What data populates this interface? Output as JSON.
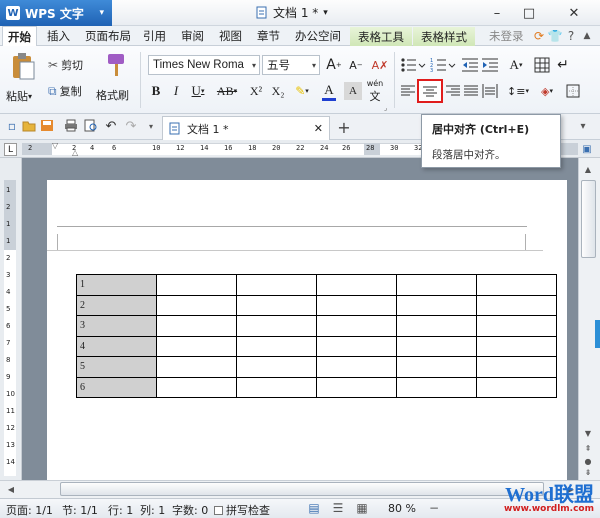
{
  "app": {
    "name": "WPS 文字",
    "dropdown": "▾"
  },
  "title": {
    "doc": "文档 1 *",
    "arrow": "▾"
  },
  "window": {
    "min": "–",
    "max": "□",
    "close": "✕"
  },
  "tabs": [
    {
      "label": "开始"
    },
    {
      "label": "插入"
    },
    {
      "label": "页面布局"
    },
    {
      "label": "引用"
    },
    {
      "label": "审阅"
    },
    {
      "label": "视图"
    },
    {
      "label": "章节"
    },
    {
      "label": "办公空间"
    },
    {
      "label": "表格工具"
    },
    {
      "label": "表格样式"
    }
  ],
  "account": {
    "login": "未登录",
    "help": "?"
  },
  "ribbon": {
    "paste": "粘贴",
    "cut": "剪切",
    "copy": "复制",
    "format_painter": "格式刷",
    "font_name": "Times New Roma",
    "font_size": "五号",
    "grow": "A",
    "shrink": "A",
    "bold": "B",
    "italic": "I",
    "underline": "U",
    "strike": "AB",
    "sup": "X²",
    "sub": "X₂",
    "font_color": "A",
    "char_shading": "A",
    "phonetic": "wén"
  },
  "tooltip": {
    "title": "居中对齐 (Ctrl+E)",
    "desc": "段落居中对齐。"
  },
  "doc_tab": {
    "label": "文档 1 *",
    "close": "✕",
    "add": "+"
  },
  "ruler": {
    "marks": [
      "2",
      "2",
      "4",
      "6",
      "10",
      "12",
      "14",
      "16",
      "18",
      "20",
      "22",
      "24",
      "26",
      "28",
      "30",
      "32",
      "34"
    ]
  },
  "vruler": {
    "marks": [
      "1",
      "2",
      "1",
      "1",
      "2",
      "3",
      "4",
      "5",
      "6",
      "7",
      "8",
      "9",
      "10",
      "11",
      "12",
      "13",
      "14"
    ]
  },
  "table": {
    "rows": [
      "1",
      "2",
      "3",
      "4",
      "5",
      "6"
    ],
    "cols": 6
  },
  "status": {
    "page": "页面: 1/1",
    "section": "节: 1/1",
    "row": "行: 1",
    "col": "列: 1",
    "chars": "字数: 0",
    "spell": "拼写检查",
    "zoom": "80 %"
  },
  "watermark": {
    "brand": "Word联盟",
    "url": "www.wordlm.com"
  },
  "colors": {
    "accent": "#1f62b4",
    "highlight": "#e01c1c",
    "tabctx": "#cfe6b5"
  }
}
